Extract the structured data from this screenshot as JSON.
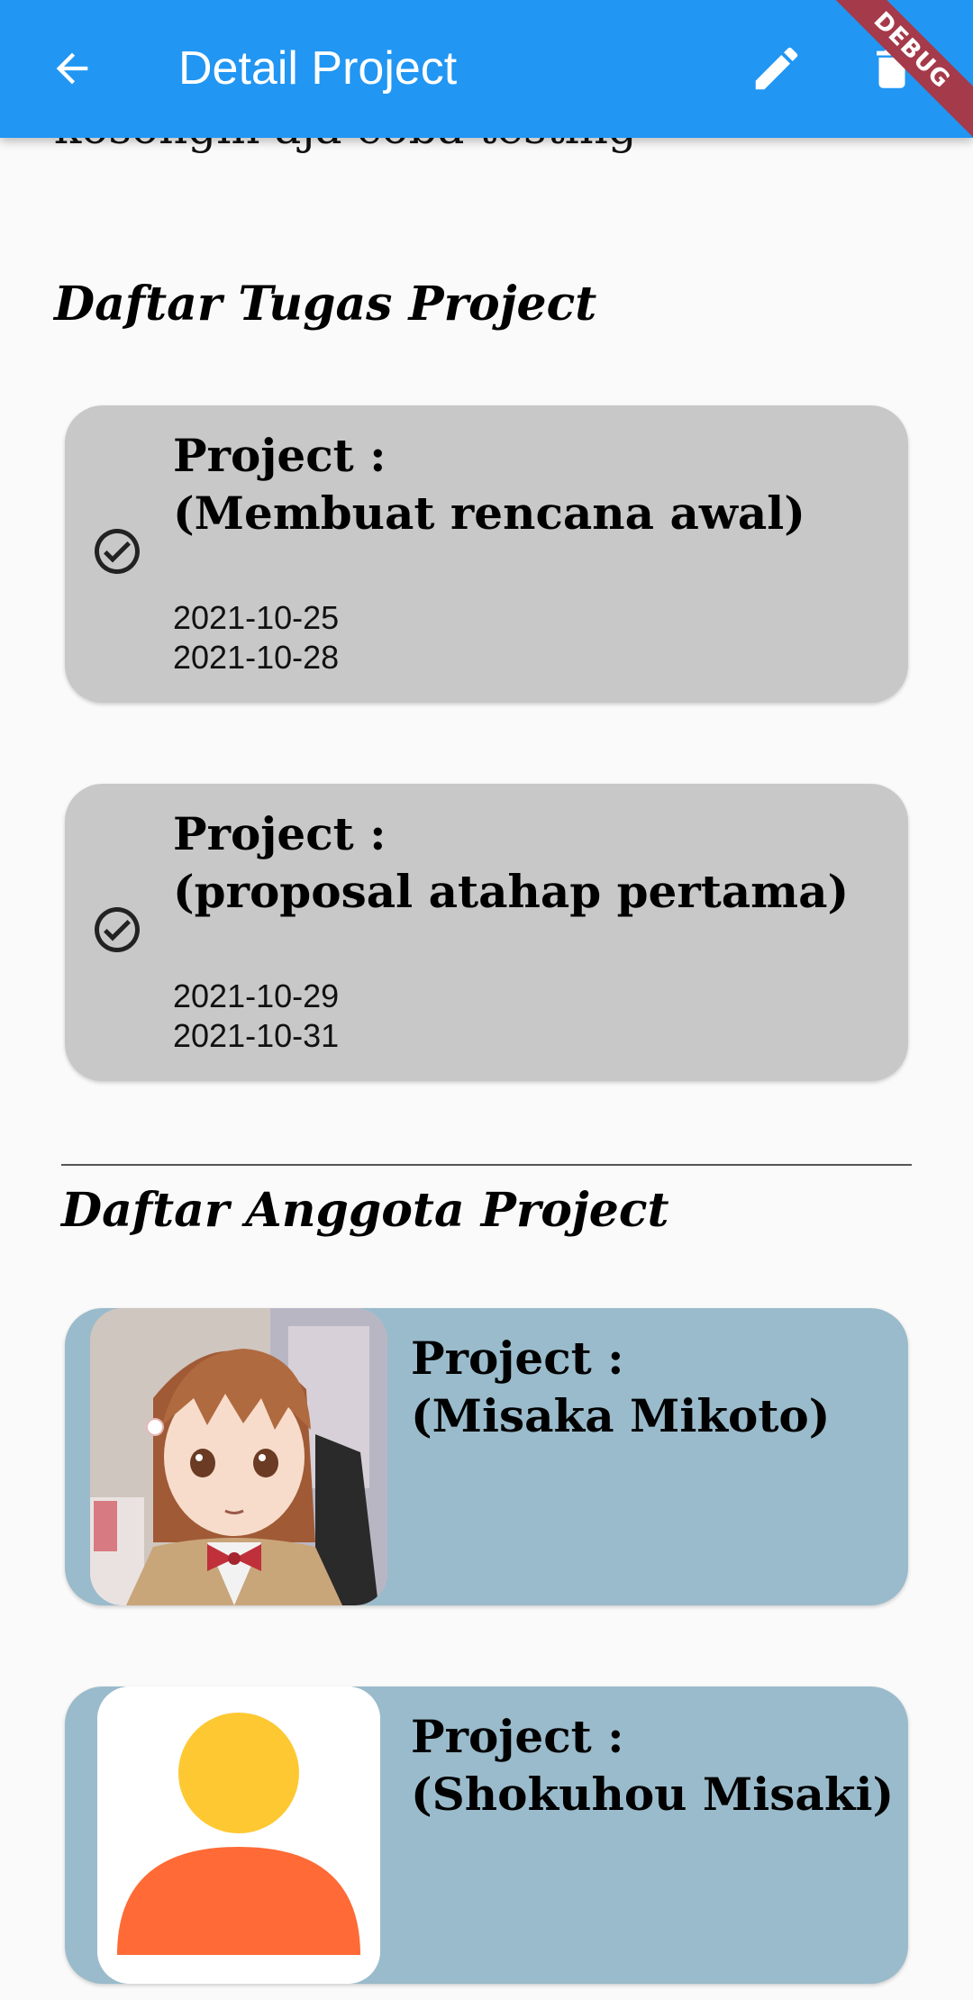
{
  "appbar": {
    "title": "Detail Project",
    "back_icon": "arrow-back-icon",
    "edit_icon": "pencil-icon",
    "delete_icon": "trash-icon",
    "background": "#2196f3",
    "debug_label": "DEBUG"
  },
  "project": {
    "description": "kosongin aja coba testing"
  },
  "tasks": {
    "title": "Daftar Tugas Project",
    "items": [
      {
        "heading_line1": "Project :",
        "heading_line2": "(Membuat rencana awal)",
        "start_date": "2021-10-25",
        "end_date": "2021-10-28",
        "status_icon": "check-circle-icon"
      },
      {
        "heading_line1": "Project :",
        "heading_line2": "(proposal atahap pertama)",
        "start_date": "2021-10-29",
        "end_date": "2021-10-31",
        "status_icon": "check-circle-icon"
      }
    ],
    "card_color": "#c8c8c8"
  },
  "members": {
    "title": "Daftar Anggota Project",
    "items": [
      {
        "heading_line1": "Project :",
        "heading_line2": "(Misaka Mikoto)",
        "avatar": "anime-girl-photo"
      },
      {
        "heading_line1": "Project :",
        "heading_line2": "(Shokuhou Misaki)",
        "avatar": "default-person-icon"
      }
    ],
    "card_color": "#9abbcb"
  }
}
